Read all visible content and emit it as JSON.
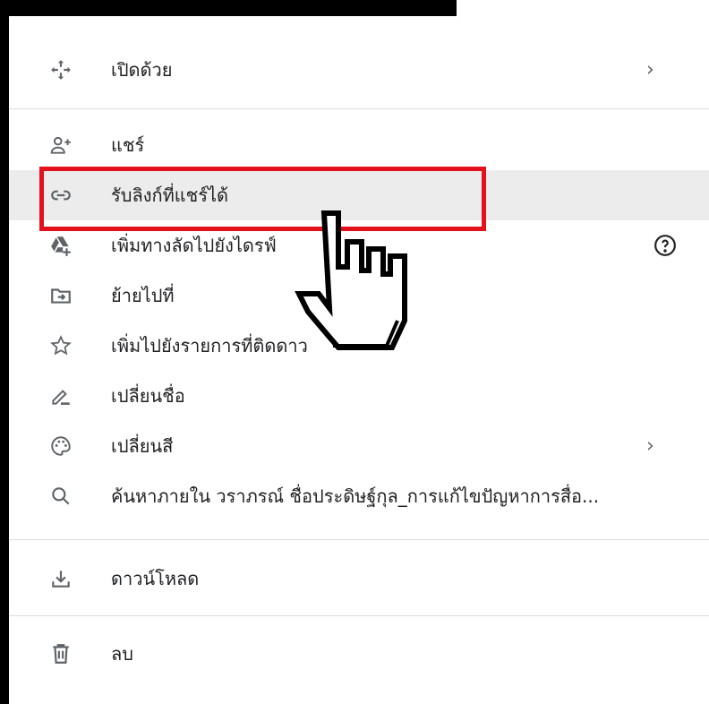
{
  "menu": {
    "items": [
      {
        "label": "เปิดด้วย",
        "icon": "move-arrows-icon",
        "submenu": true
      },
      {
        "label": "แชร์",
        "icon": "person-add-icon"
      },
      {
        "label": "รับลิงก์ที่แชร์ได้",
        "icon": "link-icon",
        "highlighted": true
      },
      {
        "label": "เพิ่มทางลัดไปยังไดรฟ์",
        "icon": "drive-add-icon",
        "help": true
      },
      {
        "label": "ย้ายไปที่",
        "icon": "folder-move-icon"
      },
      {
        "label": "เพิ่มไปยังรายการที่ติดดาว",
        "icon": "star-outline-icon"
      },
      {
        "label": "เปลี่ยนชื่อ",
        "icon": "pencil-icon"
      },
      {
        "label": "เปลี่ยนสี",
        "icon": "palette-icon",
        "submenu": true
      },
      {
        "label": "ค้นหาภายใน วราภรณ์ ชื่อประดิษฐ์กุล_การแก้ไขปัญหาการสื่อ...",
        "icon": "search-icon"
      },
      {
        "label": "ดาวน์โหลด",
        "icon": "download-icon"
      },
      {
        "label": "ลบ",
        "icon": "trash-icon"
      }
    ],
    "chevron": "›"
  },
  "colors": {
    "highlight_border": "#e3111b",
    "hover_background": "#ececec",
    "text": "#202124",
    "icon": "#5f6368"
  }
}
